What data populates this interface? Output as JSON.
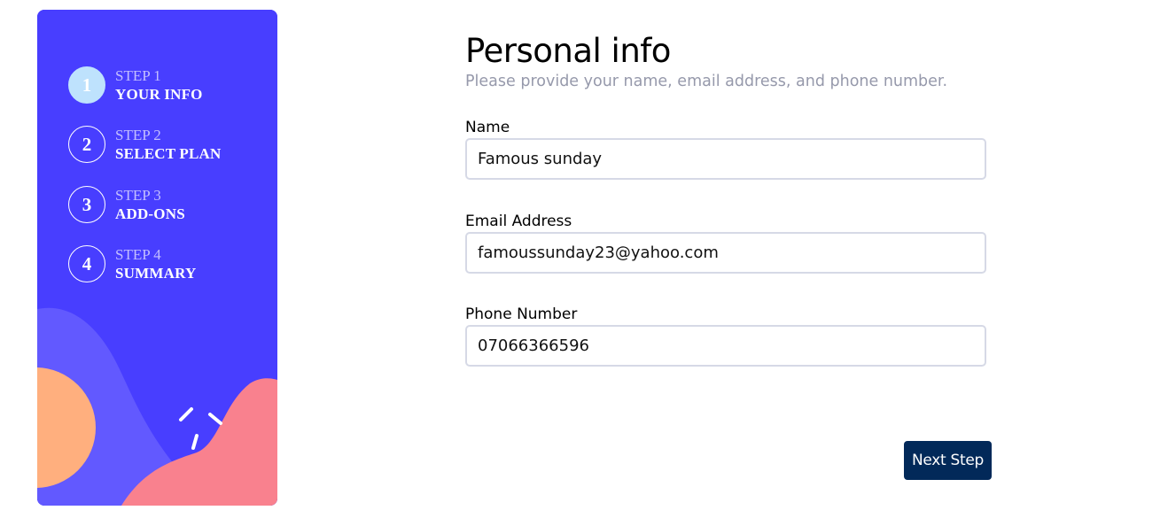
{
  "sidebar": {
    "steps": [
      {
        "number": "1",
        "label": "STEP 1",
        "title": "YOUR INFO",
        "active": true
      },
      {
        "number": "2",
        "label": "STEP 2",
        "title": "SELECT PLAN",
        "active": false
      },
      {
        "number": "3",
        "label": "STEP 3",
        "title": "ADD-ONS",
        "active": false
      },
      {
        "number": "4",
        "label": "STEP 4",
        "title": "SUMMARY",
        "active": false
      }
    ]
  },
  "main": {
    "title": "Personal info",
    "subtitle": "Please provide your name, email address, and phone number.",
    "fields": {
      "name": {
        "label": "Name",
        "value": "Famous sunday"
      },
      "email": {
        "label": "Email Address",
        "value": "famoussunday23@yahoo.com"
      },
      "phone": {
        "label": "Phone Number",
        "value": "07066366596"
      }
    },
    "next_label": "Next Step"
  },
  "colors": {
    "sidebar_bg": "#483eff",
    "active_step": "#bee2fd",
    "button_bg": "#022959",
    "subtitle": "#9699ab"
  }
}
